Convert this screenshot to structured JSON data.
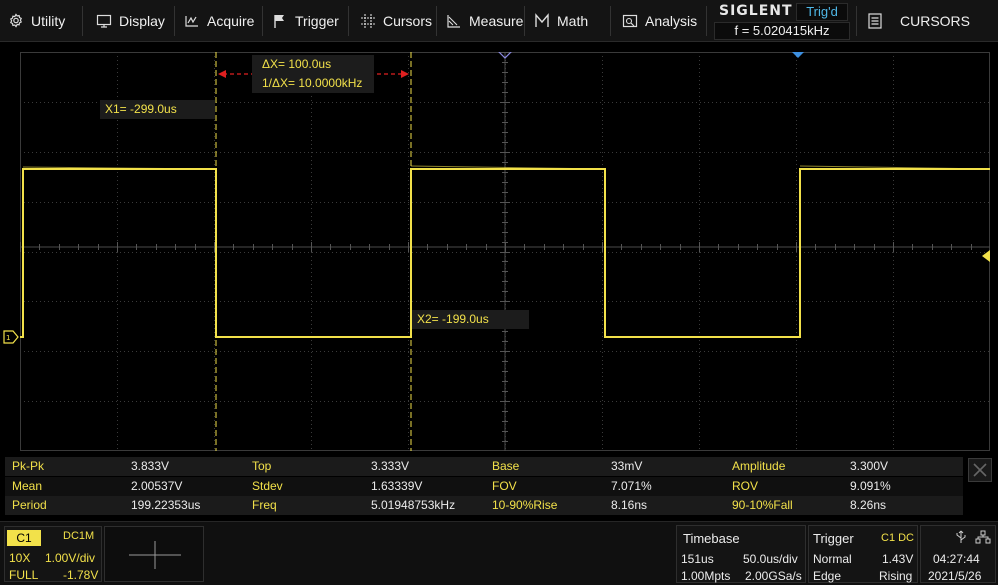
{
  "menu": {
    "items": [
      {
        "label": "Utility",
        "icon": "utility-icon"
      },
      {
        "label": "Display",
        "icon": "display-icon"
      },
      {
        "label": "Acquire",
        "icon": "acquire-icon"
      },
      {
        "label": "Trigger",
        "icon": "trigger-flag-icon"
      },
      {
        "label": "Cursors",
        "icon": "cursors-icon"
      },
      {
        "label": "Measure",
        "icon": "measure-icon"
      },
      {
        "label": "Math",
        "icon": "math-icon"
      },
      {
        "label": "Analysis",
        "icon": "analysis-icon"
      }
    ],
    "brand": "SIGLENT",
    "trigger_status": "Trig'd",
    "trigger_frequency": "f = 5.020415kHz",
    "active_menu": "CURSORS"
  },
  "cursors": {
    "delta_x": "ΔX= 100.0us",
    "inverse_delta_x": "1/ΔX= 10.0000kHz",
    "x1": "X1= -299.0us",
    "x2": "X2= -199.0us"
  },
  "measurements": [
    [
      {
        "label": "Pk-Pk",
        "value": "3.833V"
      },
      {
        "label": "Top",
        "value": "3.333V"
      },
      {
        "label": "Base",
        "value": "33mV"
      },
      {
        "label": "Amplitude",
        "value": "3.300V"
      }
    ],
    [
      {
        "label": "Mean",
        "value": "2.00537V"
      },
      {
        "label": "Stdev",
        "value": "1.63339V"
      },
      {
        "label": "FOV",
        "value": "7.071%"
      },
      {
        "label": "ROV",
        "value": "9.091%"
      }
    ],
    [
      {
        "label": "Period",
        "value": "199.22353us"
      },
      {
        "label": "Freq",
        "value": "5.01948753kHz"
      },
      {
        "label": "10-90%Rise",
        "value": "8.16ns"
      },
      {
        "label": "90-10%Fall",
        "value": "8.26ns"
      }
    ]
  ],
  "channel1": {
    "name": "C1",
    "coupling": "DC1M",
    "probe": "10X",
    "scale": "1.00V/div",
    "bandwidth": "FULL",
    "offset": "-1.78V"
  },
  "timebase": {
    "title": "Timebase",
    "delay": "151us",
    "scale": "50.0us/div",
    "memory_depth": "1.00Mpts",
    "sample_rate": "2.00GSa/s"
  },
  "trigger": {
    "title": "Trigger",
    "source": "C1 DC",
    "mode": "Normal",
    "level": "1.43V",
    "type": "Edge",
    "slope": "Rising"
  },
  "clock": {
    "time": "04:27:44",
    "date": "2021/5/26"
  },
  "colors": {
    "channel1": "#f2e14a",
    "cursor_delta_arrow": "#e02020",
    "trigger_marker": "#3d8fe0",
    "trig_status_text": "#4fb8e8"
  }
}
